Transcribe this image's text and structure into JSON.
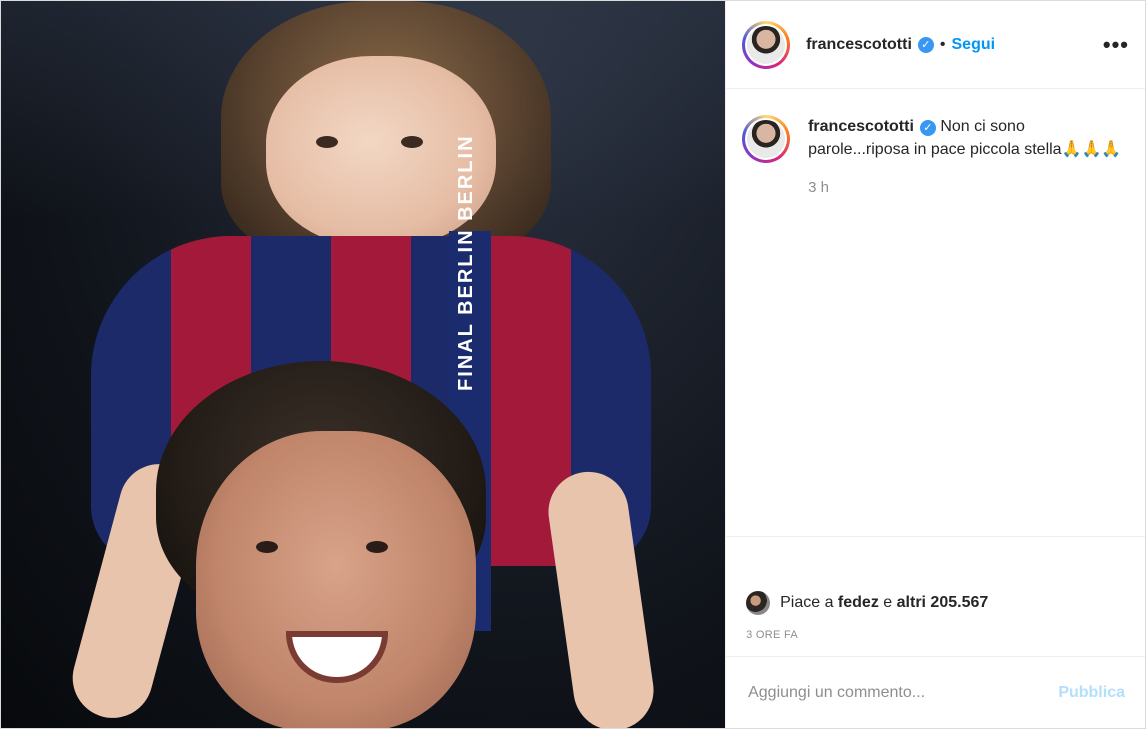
{
  "post": {
    "image_alt": "Photo",
    "lanyard_text": "FINAL BERLIN BERLIN"
  },
  "header": {
    "username": "francescototti",
    "separator": "•",
    "follow_label": "Segui",
    "more_label": "•••"
  },
  "caption": {
    "username": "francescototti",
    "text": "Non ci sono parole...riposa in pace piccola stella🙏🙏🙏",
    "time": "3 h"
  },
  "likes": {
    "prefix": "Piace a",
    "user": "fedez",
    "joiner": "e",
    "others": "altri 205.567"
  },
  "posted_ago": "3 ORE FA",
  "comment_box": {
    "placeholder": "Aggiungi un commento...",
    "publish_label": "Pubblica"
  },
  "colors": {
    "link": "#0095f6",
    "verified": "#3897f0",
    "publish_disabled": "#b2dffc",
    "muted": "#8e8e8e"
  },
  "icons": [
    "verified-badge-icon",
    "more-options-icon"
  ]
}
